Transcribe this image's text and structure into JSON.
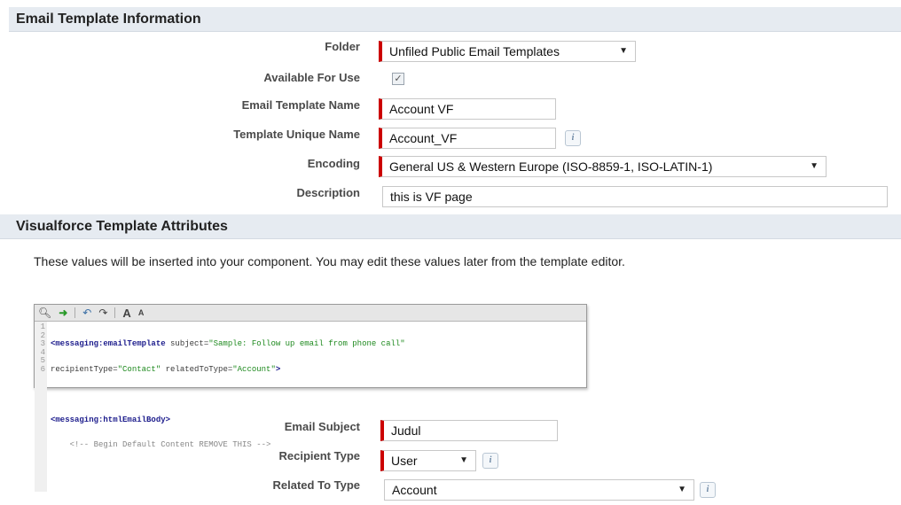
{
  "sections": {
    "email_info": "Email Template Information",
    "vf_attrs": "Visualforce Template Attributes"
  },
  "fields": {
    "folder": {
      "label": "Folder",
      "value": "Unfiled Public Email Templates"
    },
    "available": {
      "label": "Available For Use",
      "checked": true
    },
    "template_name": {
      "label": "Email Template Name",
      "value": "Account VF"
    },
    "unique_name": {
      "label": "Template Unique Name",
      "value": "Account_VF"
    },
    "encoding": {
      "label": "Encoding",
      "value": "General US & Western Europe (ISO-8859-1, ISO-LATIN-1)"
    },
    "description": {
      "label": "Description",
      "value": "this is VF page"
    },
    "email_subject": {
      "label": "Email Subject",
      "value": "Judul"
    },
    "recipient_type": {
      "label": "Recipient Type",
      "value": "User"
    },
    "related_to_type": {
      "label": "Related To Type",
      "value": "Account"
    }
  },
  "note": "These values will be inserted into your component. You may edit these values later from the template editor.",
  "editor": {
    "toolbar": [
      "search-icon",
      "go-icon",
      "undo-icon",
      "redo-icon",
      "font-larger-icon",
      "font-smaller-icon"
    ],
    "toolbar_glyphs": {
      "font_larger": "A",
      "font_smaller": "A"
    },
    "line_numbers": [
      "1",
      "2",
      "3",
      "4",
      "5",
      "6"
    ],
    "lines": {
      "l1_tag": "<messaging:emailTemplate",
      "l1_attr": " subject=",
      "l1_str": "\"Sample: Follow up email from phone call\"",
      "l2_attr": "recipientType=",
      "l2_str": "\"Contact\"",
      "l2_attr2": " relatedToType=",
      "l2_str2": "\"Account\"",
      "l2_end": ">",
      "l4_tag": "<messaging:htmlEmailBody>",
      "l5_comment": "    <!-- Begin Default Content REMOVE THIS -->"
    }
  },
  "colors": {
    "required": "#cc0000",
    "header_bg": "#e6ebf1"
  }
}
